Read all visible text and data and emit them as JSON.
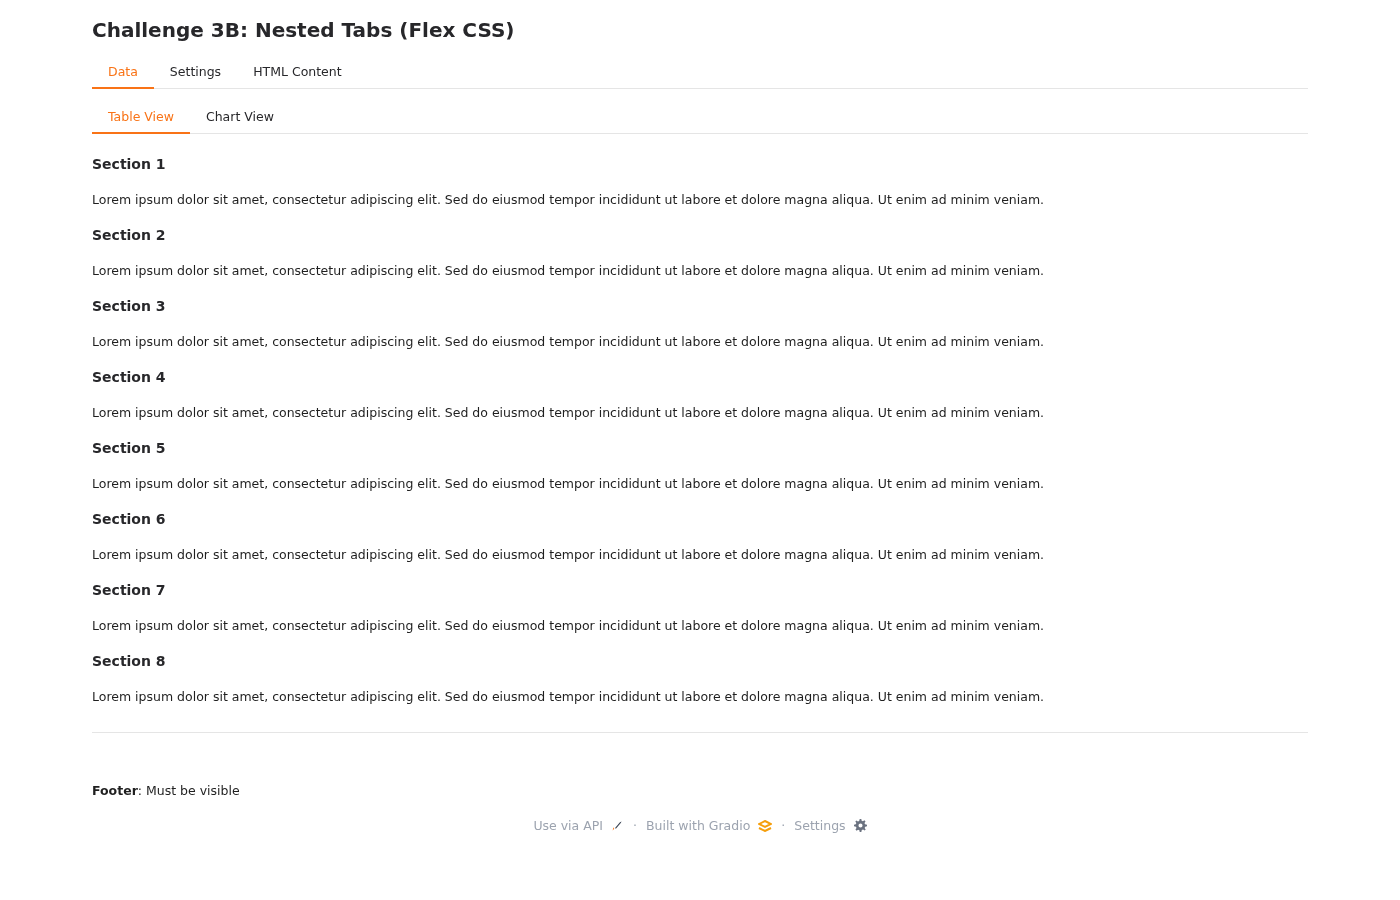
{
  "title": "Challenge 3B: Nested Tabs (Flex CSS)",
  "tabs": [
    {
      "label": "Data",
      "selected": true
    },
    {
      "label": "Settings",
      "selected": false
    },
    {
      "label": "HTML Content",
      "selected": false
    }
  ],
  "subtabs": [
    {
      "label": "Table View",
      "selected": true
    },
    {
      "label": "Chart View",
      "selected": false
    }
  ],
  "sections": [
    {
      "heading": "Section 1",
      "text": "Lorem ipsum dolor sit amet, consectetur adipiscing elit. Sed do eiusmod tempor incididunt ut labore et dolore magna aliqua. Ut enim ad minim veniam."
    },
    {
      "heading": "Section 2",
      "text": "Lorem ipsum dolor sit amet, consectetur adipiscing elit. Sed do eiusmod tempor incididunt ut labore et dolore magna aliqua. Ut enim ad minim veniam."
    },
    {
      "heading": "Section 3",
      "text": "Lorem ipsum dolor sit amet, consectetur adipiscing elit. Sed do eiusmod tempor incididunt ut labore et dolore magna aliqua. Ut enim ad minim veniam."
    },
    {
      "heading": "Section 4",
      "text": "Lorem ipsum dolor sit amet, consectetur adipiscing elit. Sed do eiusmod tempor incididunt ut labore et dolore magna aliqua. Ut enim ad minim veniam."
    },
    {
      "heading": "Section 5",
      "text": "Lorem ipsum dolor sit amet, consectetur adipiscing elit. Sed do eiusmod tempor incididunt ut labore et dolore magna aliqua. Ut enim ad minim veniam."
    },
    {
      "heading": "Section 6",
      "text": "Lorem ipsum dolor sit amet, consectetur adipiscing elit. Sed do eiusmod tempor incididunt ut labore et dolore magna aliqua. Ut enim ad minim veniam."
    },
    {
      "heading": "Section 7",
      "text": "Lorem ipsum dolor sit amet, consectetur adipiscing elit. Sed do eiusmod tempor incididunt ut labore et dolore magna aliqua. Ut enim ad minim veniam."
    },
    {
      "heading": "Section 8",
      "text": "Lorem ipsum dolor sit amet, consectetur adipiscing elit. Sed do eiusmod tempor incididunt ut labore et dolore magna aliqua. Ut enim ad minim veniam."
    }
  ],
  "footer_note": "**Footer**: Must be visible",
  "footer_links": [
    {
      "label": "Use via API",
      "kind": "api"
    },
    {
      "label": "·",
      "kind": "separator"
    },
    {
      "label": "Built with Gradio",
      "kind": "gradio"
    },
    {
      "label": "·",
      "kind": "separator"
    },
    {
      "label": "Settings",
      "kind": "settings"
    }
  ]
}
